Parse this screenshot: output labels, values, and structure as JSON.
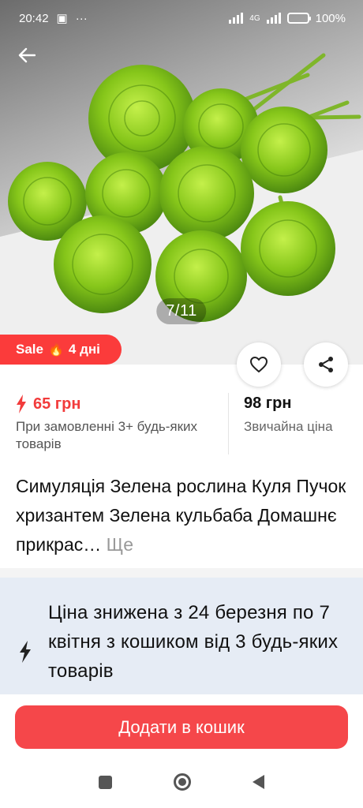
{
  "status_bar": {
    "time": "20:42",
    "extra": "···",
    "network": "4G",
    "battery": "100%"
  },
  "gallery": {
    "counter": "7/11"
  },
  "sale_badge": {
    "label": "Sale",
    "days": "4 дні"
  },
  "price": {
    "sale_price": "65 грн",
    "condition": "При замовленні 3+ будь-яких товарів",
    "regular_price": "98 грн",
    "regular_label": "Звичайна ціна"
  },
  "product": {
    "title": "Симуляція Зелена рослина Куля Пучок хризантем Зелена кульбаба Домашнє прикрас…",
    "more_label": "Ще"
  },
  "promo": {
    "text": "Ціна знижена з 24 березня по 7 квітня з кошиком від 3 будь-яких товарів"
  },
  "actions": {
    "add_to_cart": "Додати в кошик"
  },
  "colors": {
    "accent_red": "#f5474a",
    "price_red": "#f23b3b",
    "promo_bg": "#e6ecf5",
    "flower_green": "#8ccf1f"
  },
  "icons": [
    "back-arrow-icon",
    "heart-icon",
    "share-icon",
    "lightning-icon",
    "fire-icon"
  ]
}
